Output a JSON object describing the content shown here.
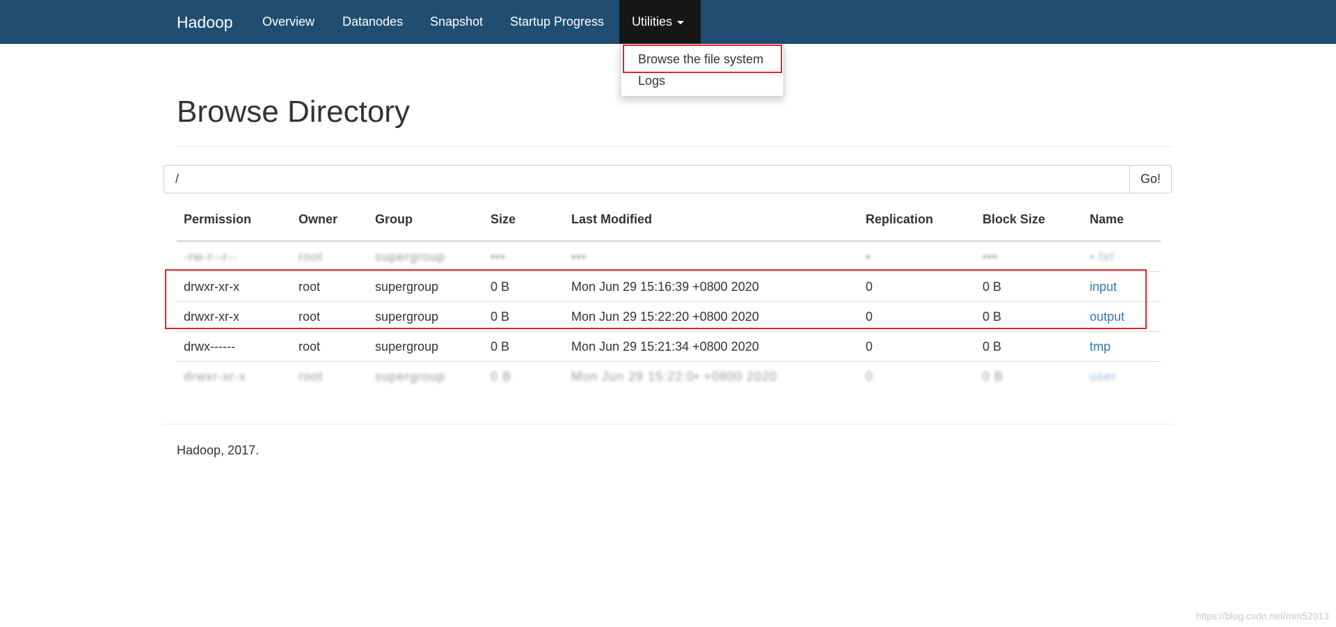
{
  "navbar": {
    "brand": "Hadoop",
    "items": [
      {
        "label": "Overview"
      },
      {
        "label": "Datanodes"
      },
      {
        "label": "Snapshot"
      },
      {
        "label": "Startup Progress"
      },
      {
        "label": "Utilities"
      }
    ],
    "dropdown": {
      "items": [
        {
          "label": "Browse the file system"
        },
        {
          "label": "Logs"
        }
      ]
    }
  },
  "page": {
    "title": "Browse Directory"
  },
  "path_bar": {
    "value": "/",
    "go_label": "Go!"
  },
  "table": {
    "headers": [
      "Permission",
      "Owner",
      "Group",
      "Size",
      "Last Modified",
      "Replication",
      "Block Size",
      "Name"
    ],
    "rows": [
      {
        "permission": "-rw-r--r--",
        "owner": "root",
        "group": "supergroup",
        "size": "•••",
        "modified": "•••",
        "replication": "•",
        "block_size": "•••",
        "name": "•.txt"
      },
      {
        "permission": "drwxr-xr-x",
        "owner": "root",
        "group": "supergroup",
        "size": "0 B",
        "modified": "Mon Jun 29 15:16:39 +0800 2020",
        "replication": "0",
        "block_size": "0 B",
        "name": "input"
      },
      {
        "permission": "drwxr-xr-x",
        "owner": "root",
        "group": "supergroup",
        "size": "0 B",
        "modified": "Mon Jun 29 15:22:20 +0800 2020",
        "replication": "0",
        "block_size": "0 B",
        "name": "output"
      },
      {
        "permission": "drwx------",
        "owner": "root",
        "group": "supergroup",
        "size": "0 B",
        "modified": "Mon Jun 29 15:21:34 +0800 2020",
        "replication": "0",
        "block_size": "0 B",
        "name": "tmp"
      },
      {
        "permission": "drwxr-xr-x",
        "owner": "root",
        "group": "supergroup",
        "size": "0 B",
        "modified": "Mon Jun 29 15:22:0• +0800 2020",
        "replication": "0",
        "block_size": "0 B",
        "name": "user"
      }
    ]
  },
  "footer": {
    "text": "Hadoop, 2017."
  },
  "watermark": {
    "text": "https://blog.csdn.net/mm52013"
  },
  "colors": {
    "navbar": "#1f4e72",
    "active_tab": "#161616",
    "link": "#337ab7",
    "highlight": "#e0212a"
  }
}
